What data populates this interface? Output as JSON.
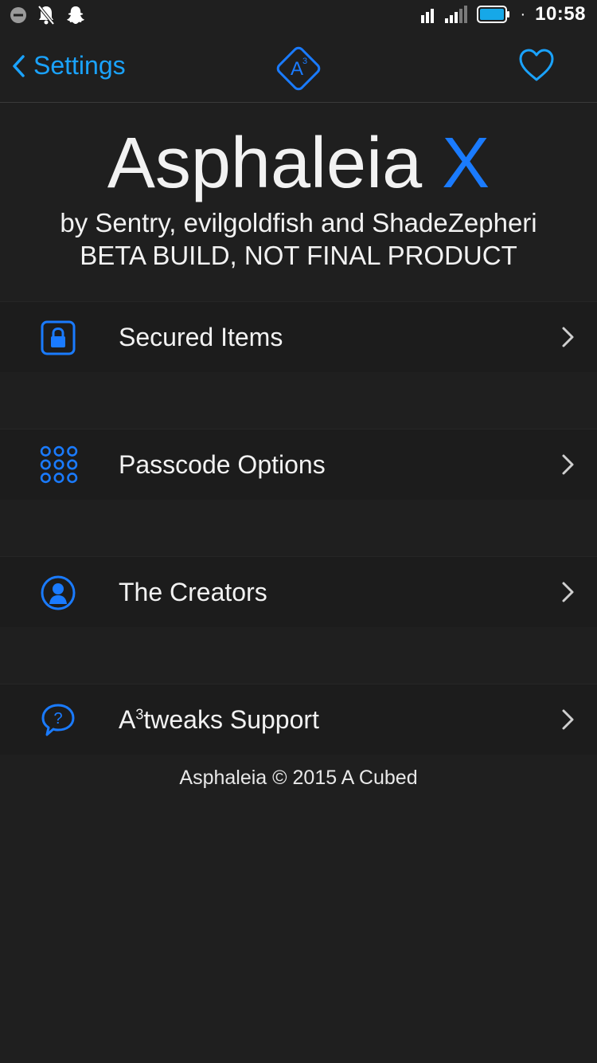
{
  "status_bar": {
    "time": "10:58",
    "separator": "·"
  },
  "nav": {
    "back_label": "Settings",
    "logo_text": "A",
    "logo_superscript": "3"
  },
  "header": {
    "title_main": "Asphaleia",
    "title_accent": "X",
    "byline": "by Sentry, evilgoldfish and ShadeZepheri",
    "beta_notice": "BETA BUILD, NOT FINAL PRODUCT"
  },
  "menu": {
    "secured_items": {
      "label": "Secured Items",
      "icon": "lock-icon"
    },
    "passcode_options": {
      "label": "Passcode Options",
      "icon": "keypad-icon"
    },
    "the_creators": {
      "label": "The Creators",
      "icon": "person-icon"
    },
    "support": {
      "label_prefix": "A",
      "label_superscript": "3",
      "label_suffix": "tweaks Support",
      "icon": "question-bubble-icon"
    }
  },
  "footer": {
    "text": "Asphaleia © 2015 A Cubed"
  },
  "colors": {
    "background": "#1f1f1f",
    "row_background": "#1c1c1c",
    "accent_blue": "#1a7bff",
    "link_blue": "#1aa3ff",
    "text": "#f2f2f2"
  }
}
